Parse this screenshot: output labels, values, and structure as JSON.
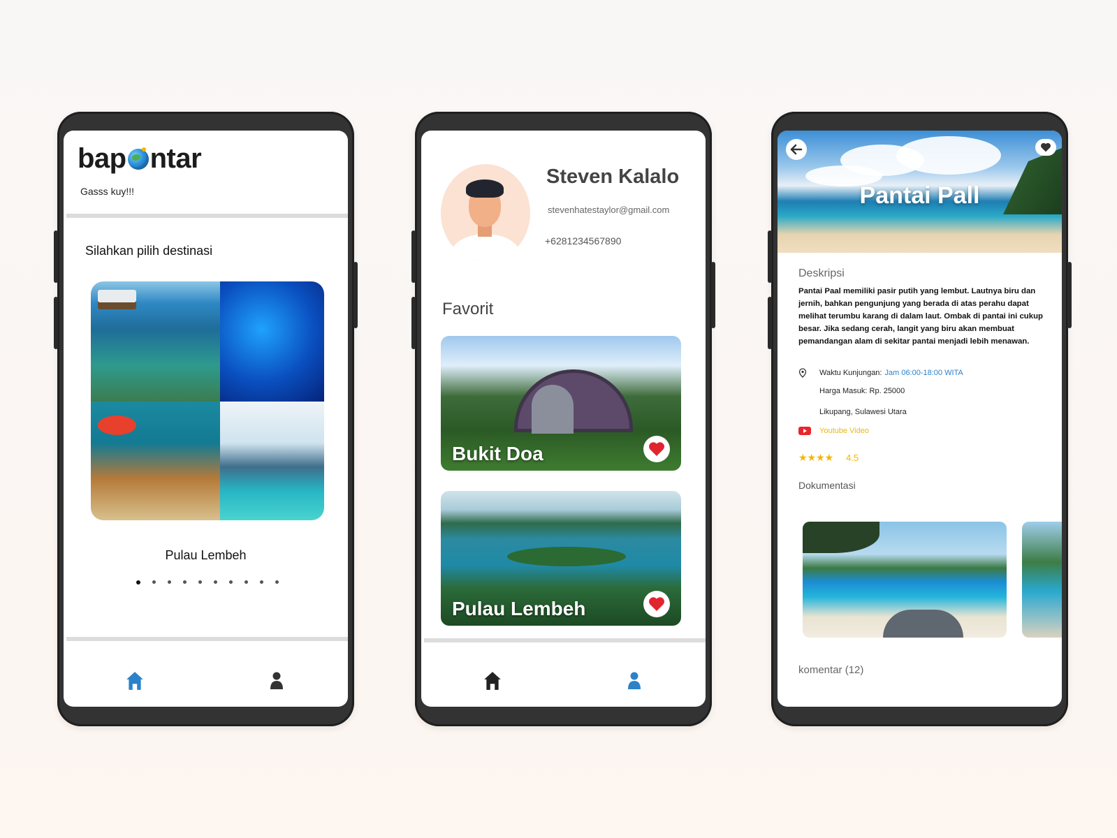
{
  "home": {
    "logo_left": "bap",
    "logo_right": "ntar",
    "tagline": "Gasss kuy!!!",
    "section_label": "Silahkan pilih destinasi",
    "destination_name": "Pulau Lembeh",
    "carousel_total": 10,
    "carousel_active": 1
  },
  "profile": {
    "name": "Steven Kalalo",
    "email": "stevenhatestaylor@gmail.com",
    "phone": "+6281234567890",
    "favorites_title": "Favorit",
    "favorites": [
      {
        "name": "Bukit Doa"
      },
      {
        "name": "Pulau Lembeh"
      }
    ]
  },
  "detail": {
    "title": "Pantai Pall",
    "description_title": "Deskripsi",
    "description": "Pantai Paal memiliki pasir putih yang lembut. Lautnya biru dan jernih, bahkan pengunjung yang berada di atas perahu dapat melihat terumbu karang di dalam laut. Ombak di pantai ini cukup besar. Jika sedang cerah, langit yang biru akan membuat pemandangan alam di sekitar pantai menjadi lebih menawan.",
    "visit_label": "Waktu Kunjungan:",
    "visit_value": "Jam 06:00-18:00 WITA",
    "price": "Harga Masuk: Rp. 25000",
    "location": "Likupang, Sulawesi Utara",
    "youtube": "Youtube Video",
    "stars": "★★★★",
    "rating": "4.5",
    "documentation_title": "Dokumentasi",
    "comments": "komentar (12)"
  },
  "colors": {
    "accent_blue": "#2b82c9",
    "heart_red": "#e0252f",
    "star_yellow": "#f5b400",
    "frame": "#333333"
  }
}
